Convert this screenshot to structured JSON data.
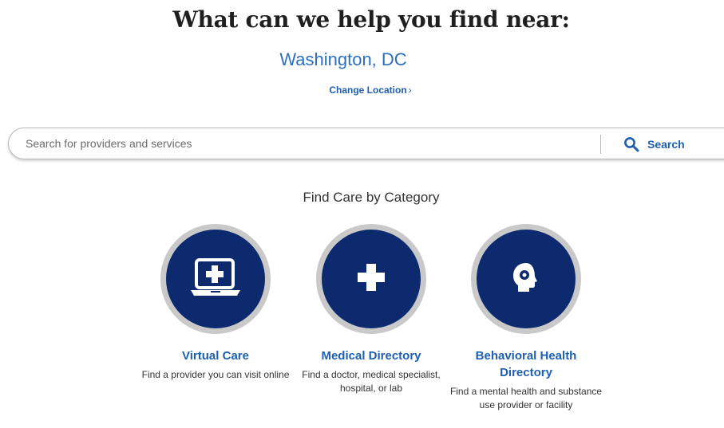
{
  "header": {
    "title": "What can we help you find near:",
    "location": "Washington, DC",
    "change_location": "Change Location",
    "change_location_chevron": "›"
  },
  "search": {
    "placeholder": "Search for providers and services",
    "value": "",
    "button_label": "Search"
  },
  "categories": {
    "title": "Find Care by Category",
    "items": [
      {
        "icon": "laptop-plus-icon",
        "title": "Virtual Care",
        "title_line2": "",
        "description": "Find a provider you can visit online"
      },
      {
        "icon": "plus-icon",
        "title": "Medical Directory",
        "title_line2": "",
        "description": "Find a doctor, medical specialist, hospital, or lab"
      },
      {
        "icon": "head-silhouette-icon",
        "title": "Behavioral Health",
        "title_line2": "Directory",
        "description": "Find a mental health and substance use provider or facility"
      }
    ]
  },
  "colors": {
    "accent": "#1d5fb0",
    "circle": "#0d2a6e",
    "circle_ring": "#c9c9c9"
  }
}
